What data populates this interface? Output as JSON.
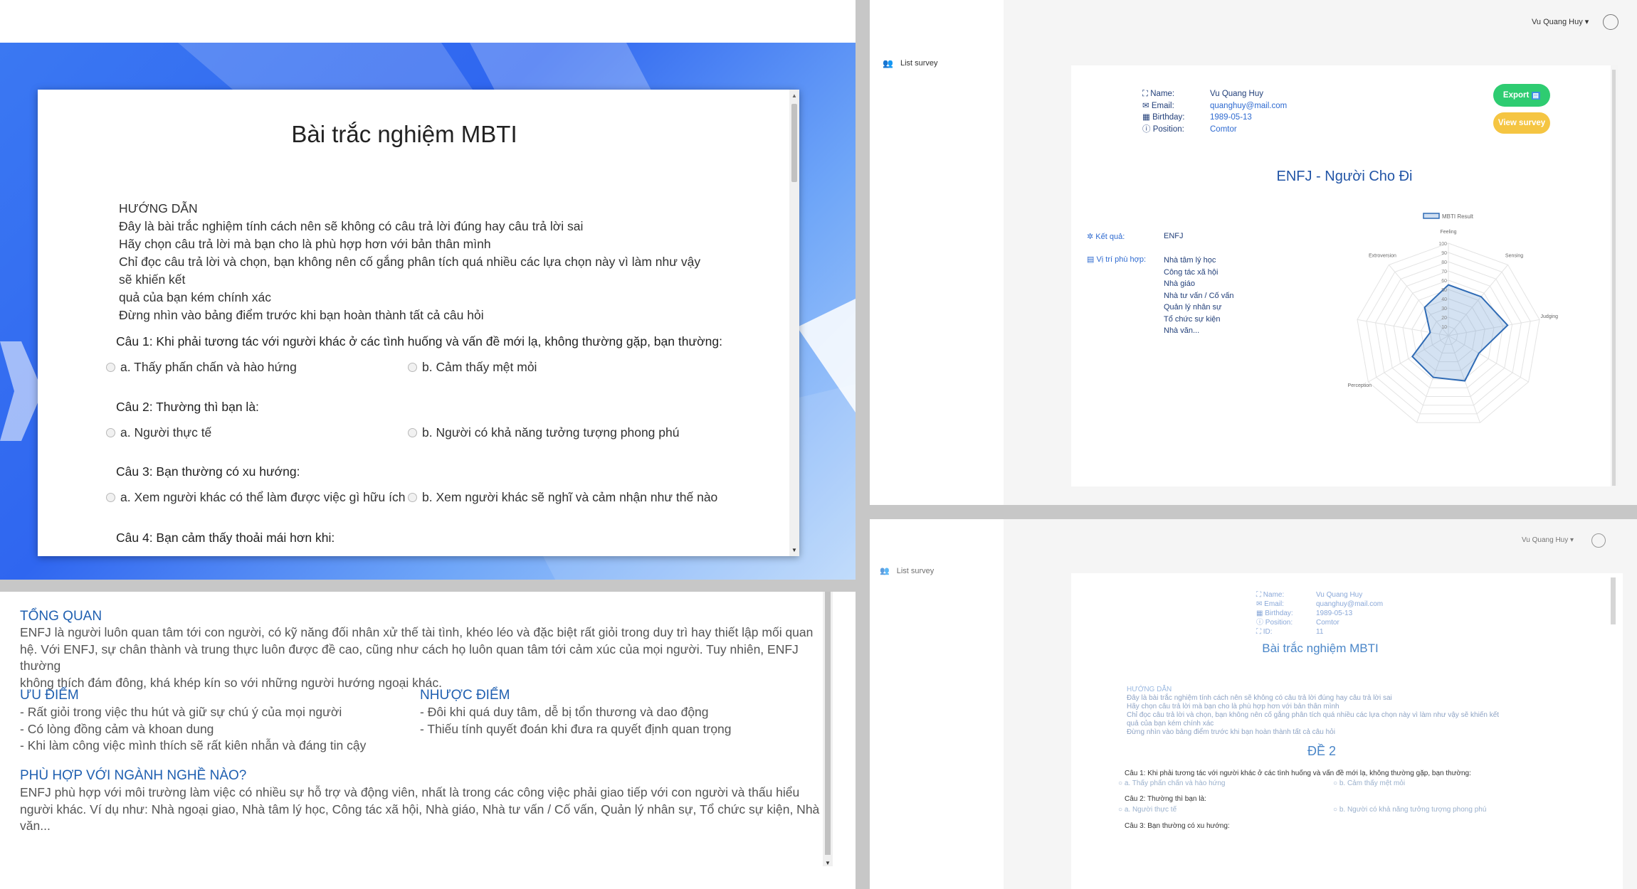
{
  "quiz": {
    "title": "Bài trắc nghiệm MBTI",
    "guide": [
      "HƯỚNG DẪN",
      "Đây là bài trắc nghiệm tính cách nên sẽ không có câu trả lời đúng hay câu trả lời sai",
      "Hãy chọn câu trả lời mà bạn cho là phù hợp hơn với bản thân mình",
      "Chỉ đọc câu trả lời và chọn, bạn không nên cố gắng phân tích quá nhiều các lựa chọn này vì làm như vậy sẽ khiến kết",
      "quả của bạn kém chính xác",
      "Đừng nhìn vào bảng điểm trước khi bạn hoàn thành tất cả câu hỏi"
    ],
    "questions": [
      {
        "q": "Câu 1:  Khi phải tương tác với người khác ở các tình huống và vấn đề mới lạ, không thường gặp, bạn thường:",
        "a": "a. Thấy phấn chấn và hào hứng",
        "b": "b. Cảm thấy mệt mỏi"
      },
      {
        "q": "Câu 2:  Thường thì bạn là:",
        "a": "a. Người thực tế",
        "b": "b. Người có khả năng tưởng tượng phong phú"
      },
      {
        "q": "Câu 3:  Bạn thường có xu hướng:",
        "a": "a. Xem người khác có thể làm được việc gì hữu ích",
        "b": "b. Xem người khác sẽ nghĩ và cảm nhận như thế nào"
      },
      {
        "q": "Câu 4:  Bạn cảm thấy thoải mái hơn khi:"
      }
    ]
  },
  "overview": {
    "h_overview": "TỔNG QUAN",
    "overview_lines": [
      "ENFJ là người luôn quan tâm tới con người, có kỹ năng đối nhân xử thế tài tình, khéo léo và đặc biệt rất giỏi trong duy trì hay thiết lập mối quan",
      "hệ. Với ENFJ, sự chân thành và trung thực luôn được đề cao, cũng như cách họ luôn quan tâm tới cảm xúc của mọi người. Tuy nhiên, ENFJ thường",
      "không thích đám đông, khá khép kín so với những người hướng ngoại khác."
    ],
    "h_strengths": "ƯU ĐIỂM",
    "strengths": [
      "- Rất giỏi trong việc thu hút và giữ sự chú ý của mọi người",
      "- Có lòng đồng cảm và khoan dung",
      "- Khi làm công việc mình thích sẽ rất kiên nhẫn và đáng tin cậy"
    ],
    "h_weaknesses": "NHƯỢC ĐIỂM",
    "weaknesses": [
      "- Đôi khi quá duy tâm, dễ bị tổn thương và dao động",
      "- Thiếu tính quyết đoán khi đưa ra quyết định quan trọng"
    ],
    "h_fit": "PHÙ HỢP VỚI NGÀNH NGHỀ NÀO?",
    "fit_lines": [
      "ENFJ phù hợp với môi trường làm việc có nhiều sự hỗ trợ và động viên, nhất là trong các công việc phải giao tiếp với con người và thấu hiểu",
      "người khác. Ví dụ như: Nhà ngoại giao, Nhà tâm lý học, Công tác xã hội, Nhà giáo, Nhà tư vấn / Cố vấn, Quản lý nhân sự, Tổ chức sự kiện, Nhà",
      "văn..."
    ]
  },
  "result": {
    "user_menu": "Vu Quang Huy",
    "nav_list_survey": "List survey",
    "labels": {
      "name": "Name:",
      "email": "Email:",
      "birthday": "Birthday:",
      "position": "Position:",
      "id": "ID:"
    },
    "values": {
      "name": "Vu Quang Huy",
      "email": "quanghuy@mail.com",
      "birthday": "1989-05-13",
      "position": "Comtor",
      "id": "11"
    },
    "export_label": "Export",
    "view_survey_label": "View survey",
    "title": "ENFJ - Người Cho Đi",
    "result_label": "Kết quả:",
    "result_value": "ENFJ",
    "jobs_label": "Vị trí phù hợp:",
    "jobs": [
      "Nhà tâm lý học",
      "Công tác xã hội",
      "Nhà giáo",
      "Nhà tư vấn / Cố vấn",
      "Quản lý nhân sự",
      "Tổ chức sự kiện",
      "Nhà văn..."
    ],
    "accent_green": "#2ecc71",
    "accent_yellow": "#f5c542"
  },
  "chart_data": {
    "type": "radar",
    "legend": "MBTI Result",
    "legend_position": "top",
    "axes": [
      "Feeling",
      "Sensing",
      "Judging",
      "Perception",
      "Extroversion"
    ],
    "axes_full_order": [
      "Feeling",
      "Sensing",
      "Judging",
      "(bottom-right)",
      "(bottom)",
      "(bottom-left)",
      "Perception",
      "Extroversion-left",
      "Extroversion"
    ],
    "ticks": [
      "100",
      "90",
      "80",
      "70",
      "60",
      "50",
      "40",
      "30",
      "20",
      "10"
    ],
    "range": [
      0,
      100
    ],
    "series": [
      {
        "name": "MBTI Result",
        "values": [
          55,
          55,
          65,
          38,
          52,
          48,
          45,
          20,
          40
        ]
      }
    ]
  },
  "survey": {
    "user_menu": "Vu Quang Huy",
    "nav_list_survey": "List survey",
    "title": "Bài trắc nghiệm MBTI",
    "guide": [
      "HƯỚNG DẪN",
      "Đây là bài trắc nghiệm tính cách nên sẽ không có câu trả lời đúng hay câu trả lời sai",
      "Hãy chọn câu trả lời mà bạn cho là phù hợp hơn với bản thân mình",
      "Chỉ đọc câu trả lời và chọn, bạn không nên cố gắng phân tích quá nhiều các lựa chọn này vì làm như vậy sẽ khiến kết",
      "quả của bạn kém chính xác",
      "Đừng nhìn vào bảng điểm trước khi bạn hoàn thành tất cả câu hỏi"
    ],
    "section": "ĐỀ 2",
    "questions": [
      {
        "q": "Câu 1:  Khi phải tương tác với người khác ở các tình huống và vấn đề mới lạ, không thường gặp, bạn thường:",
        "a": "a. Thấy phấn chấn và hào hứng",
        "b": "b. Cảm thấy mệt mỏi"
      },
      {
        "q": "Câu 2:  Thường thì bạn là:",
        "a": "a. Người thực tế",
        "b": "b. Người có khả năng tưởng tượng phong phú"
      },
      {
        "q": "Câu 3:  Bạn thường có xu hướng:"
      }
    ]
  }
}
